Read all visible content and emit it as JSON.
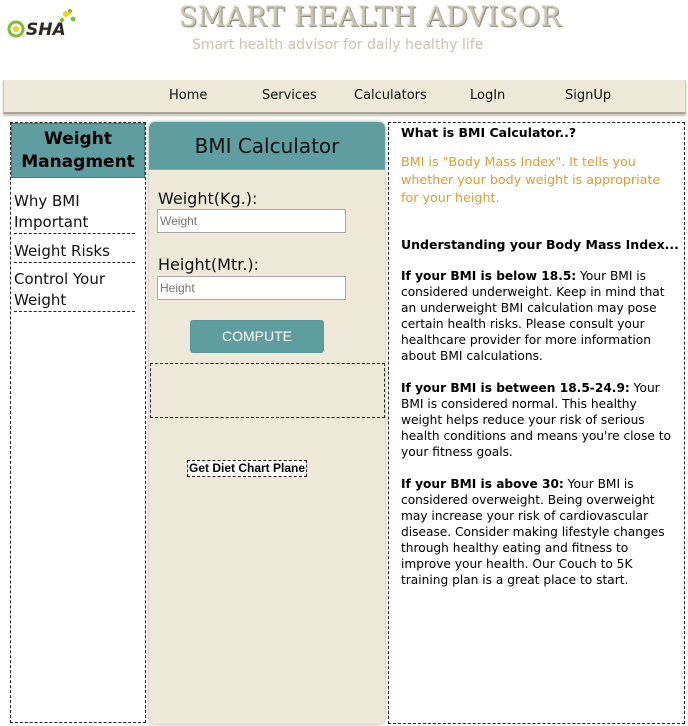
{
  "header": {
    "logo_text": "SHA",
    "title": "SMART HEALTH ADVISOR",
    "subtitle": "Smart health advisor for daily healthy life"
  },
  "nav": {
    "items": [
      {
        "label": "Home"
      },
      {
        "label": "Services"
      },
      {
        "label": "Calculators"
      },
      {
        "label": "LogIn"
      },
      {
        "label": "SignUp"
      }
    ]
  },
  "sidebar": {
    "heading": "Weight Managment",
    "links": [
      {
        "label": "Why BMI Important"
      },
      {
        "label": "Weight Risks"
      },
      {
        "label": "Control Your Weight"
      }
    ]
  },
  "calculator": {
    "title": "BMI Calculator",
    "weight_label": "Weight(Kg.):",
    "weight_placeholder": "Weight",
    "height_label": "Height(Mtr.):",
    "height_placeholder": "Height",
    "compute_label": "COMPUTE",
    "diet_link": "Get Diet Chart Plane"
  },
  "content": {
    "question": "What is BMI Calculator..?",
    "intro": "BMI is \"Body Mass Index\". It tells you whether your body weight is appropriate for your height.",
    "understanding": "Understanding your Body Mass Index...",
    "sections": [
      {
        "lead": "If your BMI is below 18.5:",
        "text": " Your BMI is considered underweight. Keep in mind that an underweight BMI calculation may pose certain health risks. Please consult your healthcare provider for more information about BMI calculations."
      },
      {
        "lead": "If your BMI is between 18.5-24.9:",
        "text": " Your BMI is considered normal. This healthy weight helps reduce your risk of serious health conditions and means you're close to your fitness goals."
      },
      {
        "lead": "If your BMI is above 30:",
        "text": " Your BMI is considered overweight. Being overweight may increase your risk of cardiovascular disease. Consider making lifestyle changes through healthy eating and fitness to improve your health. Our Couch to 5K training plan is a great place to start."
      }
    ]
  },
  "colors": {
    "accent": "#5f9ea0",
    "panel": "#efe9d9",
    "intro_text": "#e69a2e"
  }
}
